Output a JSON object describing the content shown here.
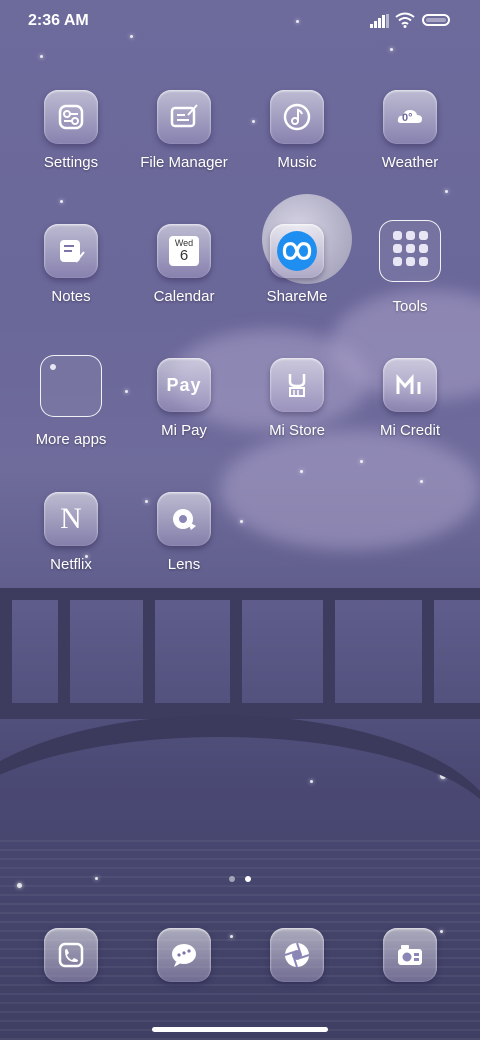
{
  "status_bar": {
    "time": "2:36 AM"
  },
  "apps": [
    {
      "label": "Settings",
      "icon": "settings-icon"
    },
    {
      "label": "File Manager",
      "icon": "file-manager-icon"
    },
    {
      "label": "Music",
      "icon": "music-icon"
    },
    {
      "label": "Weather",
      "icon": "weather-icon",
      "badge": "0°"
    },
    {
      "label": "Notes",
      "icon": "notes-icon"
    },
    {
      "label": "Calendar",
      "icon": "calendar-icon",
      "day_name": "Wed",
      "day_number": "6"
    },
    {
      "label": "ShareMe",
      "icon": "shareme-icon"
    },
    {
      "label": "Tools",
      "icon": "folder-icon"
    },
    {
      "label": "More apps",
      "icon": "folder-icon"
    },
    {
      "label": "Mi Pay",
      "icon": "mi-pay-icon",
      "glyph": "Pay"
    },
    {
      "label": "Mi Store",
      "icon": "mi-store-icon"
    },
    {
      "label": "Mi Credit",
      "icon": "mi-credit-icon"
    },
    {
      "label": "Netflix",
      "icon": "netflix-icon",
      "glyph": "N"
    },
    {
      "label": "Lens",
      "icon": "lens-icon"
    }
  ],
  "dock": [
    {
      "icon": "phone-icon"
    },
    {
      "icon": "messages-icon"
    },
    {
      "icon": "browser-icon"
    },
    {
      "icon": "camera-icon"
    }
  ],
  "page_indicator": {
    "pages": 2,
    "current": 2
  },
  "colors": {
    "shareme_accent": "#1e8ff0",
    "background": "#6d6a9c"
  }
}
